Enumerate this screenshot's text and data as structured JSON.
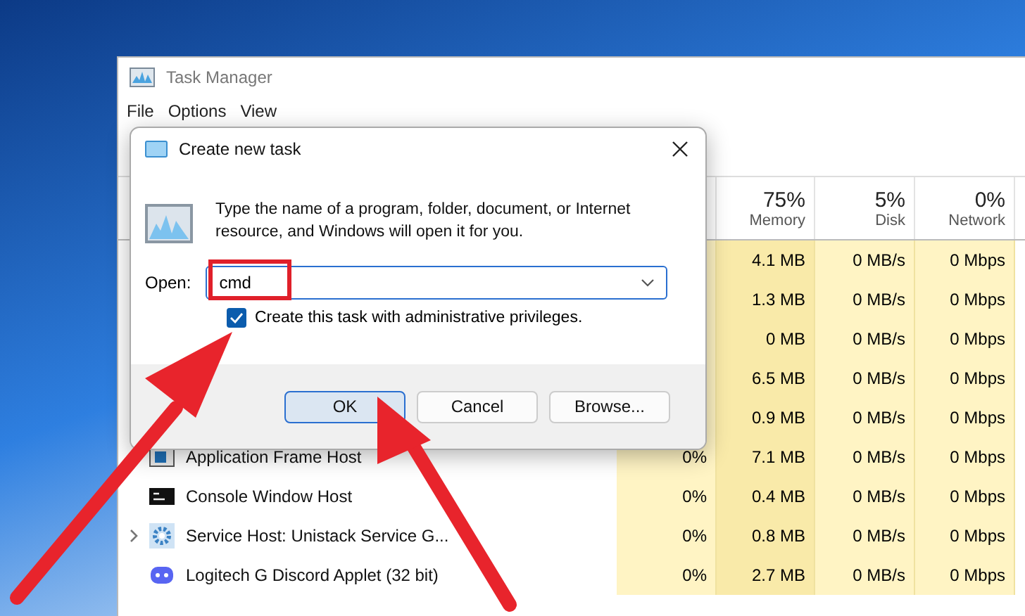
{
  "window": {
    "title": "Task Manager"
  },
  "menu": [
    "File",
    "Options",
    "View"
  ],
  "table": {
    "columns": [
      {
        "percent": "75%",
        "label": "Memory"
      },
      {
        "percent": "5%",
        "label": "Disk"
      },
      {
        "percent": "0%",
        "label": "Network"
      }
    ],
    "rows": [
      {
        "kind": "hidden",
        "memory": "4.1 MB",
        "disk": "0 MB/s",
        "network": "0 Mbps",
        "expandable": false
      },
      {
        "kind": "hidden",
        "memory": "1.3 MB",
        "disk": "0 MB/s",
        "network": "0 Mbps",
        "expandable": false
      },
      {
        "kind": "hidden",
        "memory": "0 MB",
        "disk": "0 MB/s",
        "network": "0 Mbps",
        "expandable": false
      },
      {
        "kind": "hidden",
        "memory": "6.5 MB",
        "disk": "0 MB/s",
        "network": "0 Mbps",
        "expandable": false
      },
      {
        "kind": "hidden",
        "memory": "0.9 MB",
        "disk": "0 MB/s",
        "network": "0 Mbps",
        "expandable": false
      },
      {
        "kind": "frame",
        "name": "Application Frame Host",
        "cpu": "0%",
        "memory": "7.1 MB",
        "disk": "0 MB/s",
        "network": "0 Mbps",
        "expandable": false
      },
      {
        "kind": "console",
        "name": "Console Window Host",
        "cpu": "0%",
        "memory": "0.4 MB",
        "disk": "0 MB/s",
        "network": "0 Mbps",
        "expandable": false
      },
      {
        "kind": "gear",
        "name": "Service Host: Unistack Service G...",
        "cpu": "0%",
        "memory": "0.8 MB",
        "disk": "0 MB/s",
        "network": "0 Mbps",
        "expandable": true
      },
      {
        "kind": "chat",
        "name": "Logitech G Discord Applet (32 bit)",
        "cpu": "0%",
        "memory": "2.7 MB",
        "disk": "0 MB/s",
        "network": "0 Mbps",
        "expandable": false
      }
    ]
  },
  "dialog": {
    "title": "Create new task",
    "message": "Type the name of a program, folder, document, or Internet resource, and Windows will open it for you.",
    "open_label": "Open:",
    "open_value": "cmd",
    "admin": {
      "label": "Create this task with administrative privileges.",
      "checked": true
    },
    "buttons": [
      {
        "label": "OK",
        "selected": true
      },
      {
        "label": "Cancel",
        "selected": false
      },
      {
        "label": "Browse...",
        "selected": false
      }
    ]
  }
}
